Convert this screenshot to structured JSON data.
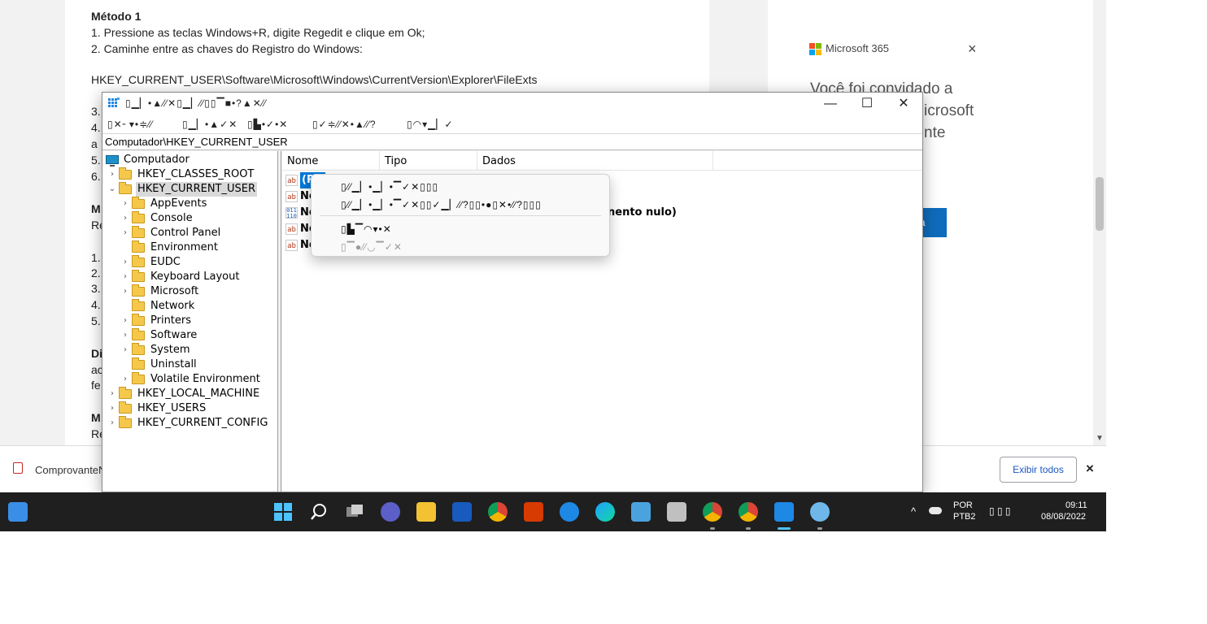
{
  "article": {
    "lines": [
      "Método 1",
      "1. Pressione as teclas Windows+R, digite Regedit e clique em Ok;",
      "2. Caminhe entre as chaves do Registro do Windows:",
      "",
      "HKEY_CURRENT_USER\\Software\\Microsoft\\Windows\\CurrentVersion\\Explorer\\FileExts"
    ],
    "fragments": [
      "3.",
      "4.",
      "a",
      "5.",
      "6.",
      "M",
      "Re",
      "1.",
      "2.",
      "3.",
      "4.",
      "5.",
      "Di",
      "ac",
      "fe",
      "M",
      "Re"
    ]
  },
  "sidebar_ad": {
    "brand": "Microsoft 365",
    "invite_lines": [
      "Você foi convidado a",
      "icrosoft",
      "nte"
    ],
    "button_fragment": "ra",
    "brand_colors": [
      "#f25022",
      "#7fba00",
      "#00a4ef",
      "#ffb900"
    ]
  },
  "downloads": {
    "file_name": "ComprovanteN",
    "show_all": "Exibir todos",
    "close_icon": "×"
  },
  "regedit": {
    "title_glyphs": "▯▁▏•▲⁄⁄✕▯▁▏⁄⁄▯▯▔■•?▲✕⁄⁄",
    "menu": [
      "▯✕╴▾•≑⁄⁄",
      "▯▁▏•▲✓✕",
      "▯▙•✓•✕",
      "▯✓≑⁄⁄✕•▲⁄⁄?",
      "▯◠▾▁▏✓"
    ],
    "window_buttons": {
      "minimize": "—",
      "maximize": "☐",
      "close": "✕"
    },
    "address": "Computador\\HKEY_CURRENT_USER",
    "tree": {
      "root": "Computador",
      "hives": [
        "HKEY_CLASSES_ROOT",
        "HKEY_CURRENT_USER",
        "HKEY_LOCAL_MACHINE",
        "HKEY_USERS",
        "HKEY_CURRENT_CONFIG"
      ],
      "children": [
        "AppEvents",
        "Console",
        "Control Panel",
        "Environment",
        "EUDC",
        "Keyboard Layout",
        "Microsoft",
        "Network",
        "Printers",
        "Software",
        "System",
        "Uninstall",
        "Volatile Environment"
      ]
    },
    "columns": [
      "Nome",
      "Tipo",
      "Dados"
    ],
    "values": [
      {
        "name": "(P",
        "icon": "ab"
      },
      {
        "name": "No",
        "icon": "ab"
      },
      {
        "name": "No",
        "icon": "bin",
        "data": "nento nulo)"
      },
      {
        "name": "No",
        "icon": "ab"
      },
      {
        "name": "No",
        "icon": "ab"
      }
    ],
    "context_menu": [
      "▯⁄⁄▁▏•▁▏•▔✓✕▯▯▯",
      "▯⁄⁄▁▏•▁▏•▔✓✕▯▯✓▁▏⁄⁄?▯▯•●▯✕•⁄⁄?▯▯▯",
      "▯▙▔◠▾•✕",
      "▯▔●⁄⁄◡▔✓✕"
    ]
  },
  "taskbar": {
    "lang_top": "POR",
    "lang_bottom": "PTB2",
    "time": "09:11",
    "date": "08/08/2022",
    "tray_glyphs": "▯ ▯ ▯",
    "chevron": "^"
  }
}
